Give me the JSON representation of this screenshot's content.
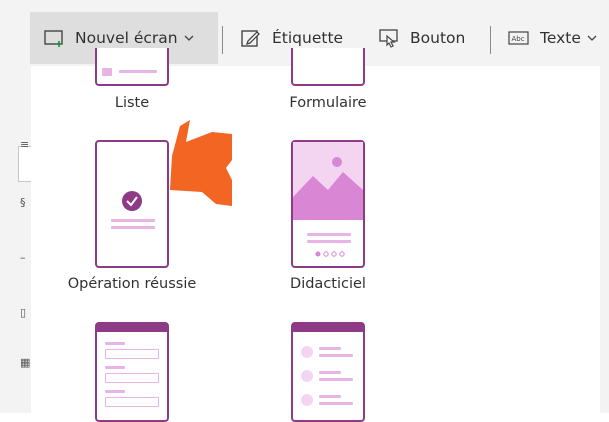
{
  "toolbar": {
    "new_screen_label": "Nouvel écran",
    "label_label": "Étiquette",
    "button_label": "Bouton",
    "text_label": "Texte"
  },
  "tiles": {
    "list_label": "Liste",
    "form_label": "Formulaire",
    "success_label": "Opération réussie",
    "tutorial_label": "Didacticiel"
  },
  "icons": {
    "new_screen": "new-screen-icon",
    "label": "pencil-icon",
    "button": "pointer-button-icon",
    "text": "text-box-icon"
  },
  "colors": {
    "accent": "#8d3a87",
    "accent_light": "#e7b4e5",
    "arrow": "#f26522"
  }
}
